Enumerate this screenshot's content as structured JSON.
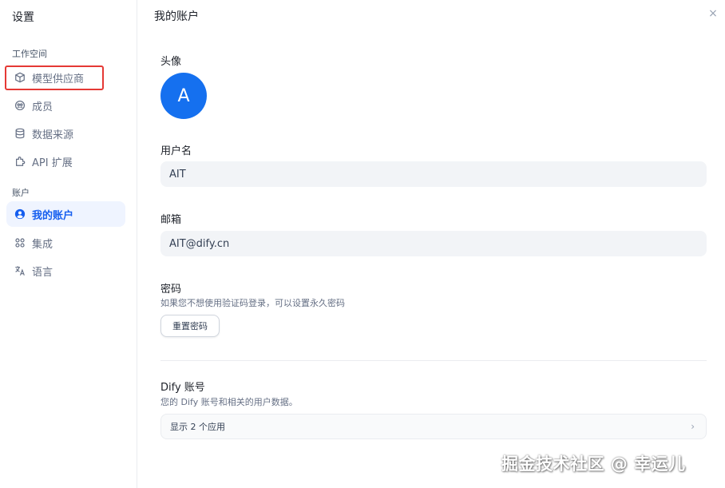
{
  "sidebar": {
    "title": "设置",
    "workspace_group": "工作空间",
    "account_group": "账户",
    "items": [
      {
        "label": "模型供应商",
        "icon": "cube-icon"
      },
      {
        "label": "成员",
        "icon": "members-icon"
      },
      {
        "label": "数据来源",
        "icon": "database-icon"
      },
      {
        "label": "API 扩展",
        "icon": "puzzle-icon"
      },
      {
        "label": "我的账户",
        "icon": "user-circle-icon",
        "active": true
      },
      {
        "label": "集成",
        "icon": "integrations-icon"
      },
      {
        "label": "语言",
        "icon": "translate-icon"
      }
    ]
  },
  "main": {
    "title": "我的账户",
    "avatar_label": "头像",
    "avatar_letter": "A",
    "username_label": "用户名",
    "username_value": "AIT",
    "email_label": "邮箱",
    "email_value": "AIT@dify.cn",
    "password_label": "密码",
    "password_hint": "如果您不想使用验证码登录，可以设置永久密码",
    "reset_password_button": "重置密码",
    "dify_account_label": "Dify 账号",
    "dify_account_hint": "您的 Dify 账号和相关的用户数据。",
    "apps_row_label": "显示 2 个应用"
  },
  "colors": {
    "accent": "#155eef",
    "avatar_bg": "#1570ef",
    "highlight_box": "#e53935"
  },
  "watermark": "掘金技术社区 @ 幸运儿"
}
